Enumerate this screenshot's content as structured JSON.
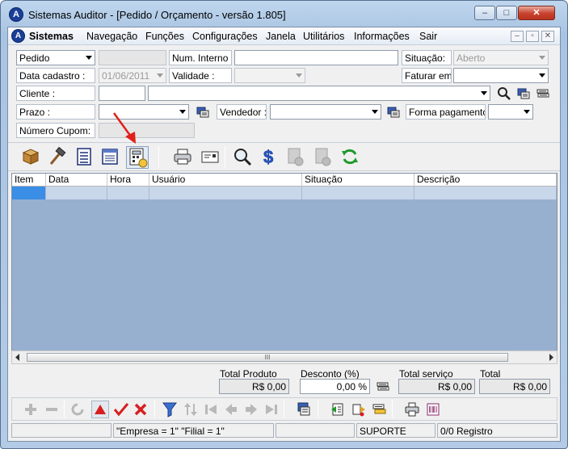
{
  "window": {
    "title": "Sistemas Auditor - [Pedido / Orçamento - versão 1.805]",
    "icon_letter": "A",
    "minimize": "–",
    "maximize": "□",
    "close": "✕"
  },
  "menu": {
    "items": [
      "Sistemas",
      "Navegação",
      "Funções",
      "Configurações",
      "Janela",
      "Utilitários",
      "Informações",
      "Sair"
    ],
    "mdi_min": "–",
    "mdi_restore": "▫",
    "mdi_close": "✕"
  },
  "form": {
    "tipo_value": "Pedido",
    "num_interno_label": "Num. Interno :",
    "num_interno_value": "",
    "situacao_label": "Situação:",
    "situacao_value": "Aberto",
    "data_cadastro_label": "Data cadastro :",
    "data_cadastro_value": "01/06/2011",
    "validade_label": "Validade :",
    "validade_value": "",
    "faturar_em_label": "Faturar em:",
    "faturar_em_value": "",
    "cliente_label": "Cliente :",
    "cliente_code": "",
    "cliente_name": "",
    "prazo_label": "Prazo :",
    "prazo_value": "",
    "vendedor_label": "Vendedor :",
    "vendedor_value": "",
    "forma_pagamento_label": "Forma pagamento:",
    "forma_pagamento_value": "",
    "numero_cupom_label": "Número Cupom:",
    "numero_cupom_value": ""
  },
  "toolbar_icons": [
    "box-icon",
    "hammer-icon",
    "document-list-icon",
    "document-view-icon",
    "calculator-document-icon",
    "printer-icon",
    "envelope-icon",
    "magnifier-icon",
    "dollar-icon",
    "document-lock-icon",
    "document-lock-icon",
    "refresh-icon"
  ],
  "grid": {
    "columns": [
      "Item",
      "Data",
      "Hora",
      "Usuário",
      "Situação",
      "Descrição"
    ],
    "scroll_thumb": "III"
  },
  "totals": {
    "total_produto_label": "Total Produto",
    "total_produto_value": "R$ 0,00",
    "desconto_label": "Desconto (%)",
    "desconto_value": "0,00 %",
    "total_servico_label": "Total serviço",
    "total_servico_value": "R$ 0,00",
    "total_label": "Total",
    "total_value": "R$ 0,00"
  },
  "status": {
    "cell1": "",
    "empresa_filial": "\"Empresa = 1\"   \"Filial = 1\"",
    "cell3": "",
    "usuario": "SUPORTE",
    "registro": "0/0 Registro"
  },
  "colors": {
    "grid_background": "#98b0d0",
    "selected_cell": "#3a8ee6",
    "arrow": "#e0201a"
  }
}
